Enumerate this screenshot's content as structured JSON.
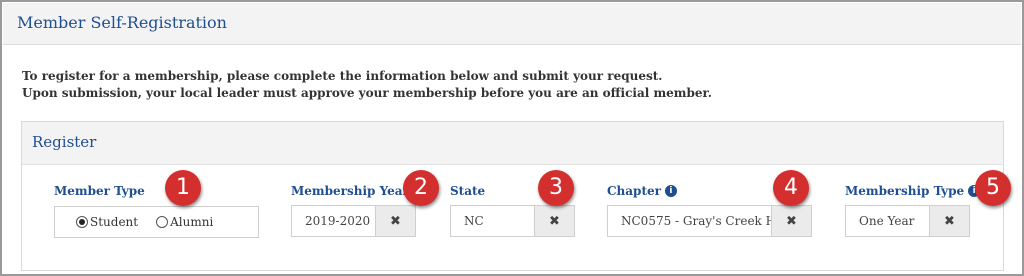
{
  "header": {
    "title": "Member Self-Registration"
  },
  "intro": {
    "line1": "To register for a membership, please complete the information below and submit your request.",
    "line2": "Upon submission, your local leader must approve your membership before you are an official member."
  },
  "register": {
    "title": "Register",
    "member_type": {
      "label": "Member Type",
      "options": [
        {
          "label": "Student",
          "checked": true
        },
        {
          "label": "Alumni",
          "checked": false
        }
      ]
    },
    "membership_year": {
      "label": "Membership Year",
      "value": "2019-2020"
    },
    "state": {
      "label": "State",
      "value": "NC"
    },
    "chapter": {
      "label": "Chapter",
      "value": "NC0575 - Gray's Creek H"
    },
    "membership_type": {
      "label": "Membership Type",
      "value": "One Year"
    },
    "clear_symbol": "✖",
    "info_symbol": "i"
  },
  "callouts": [
    "1",
    "2",
    "3",
    "4",
    "5"
  ],
  "colors": {
    "accent": "#1f4e91",
    "callout": "#d32f2f"
  }
}
